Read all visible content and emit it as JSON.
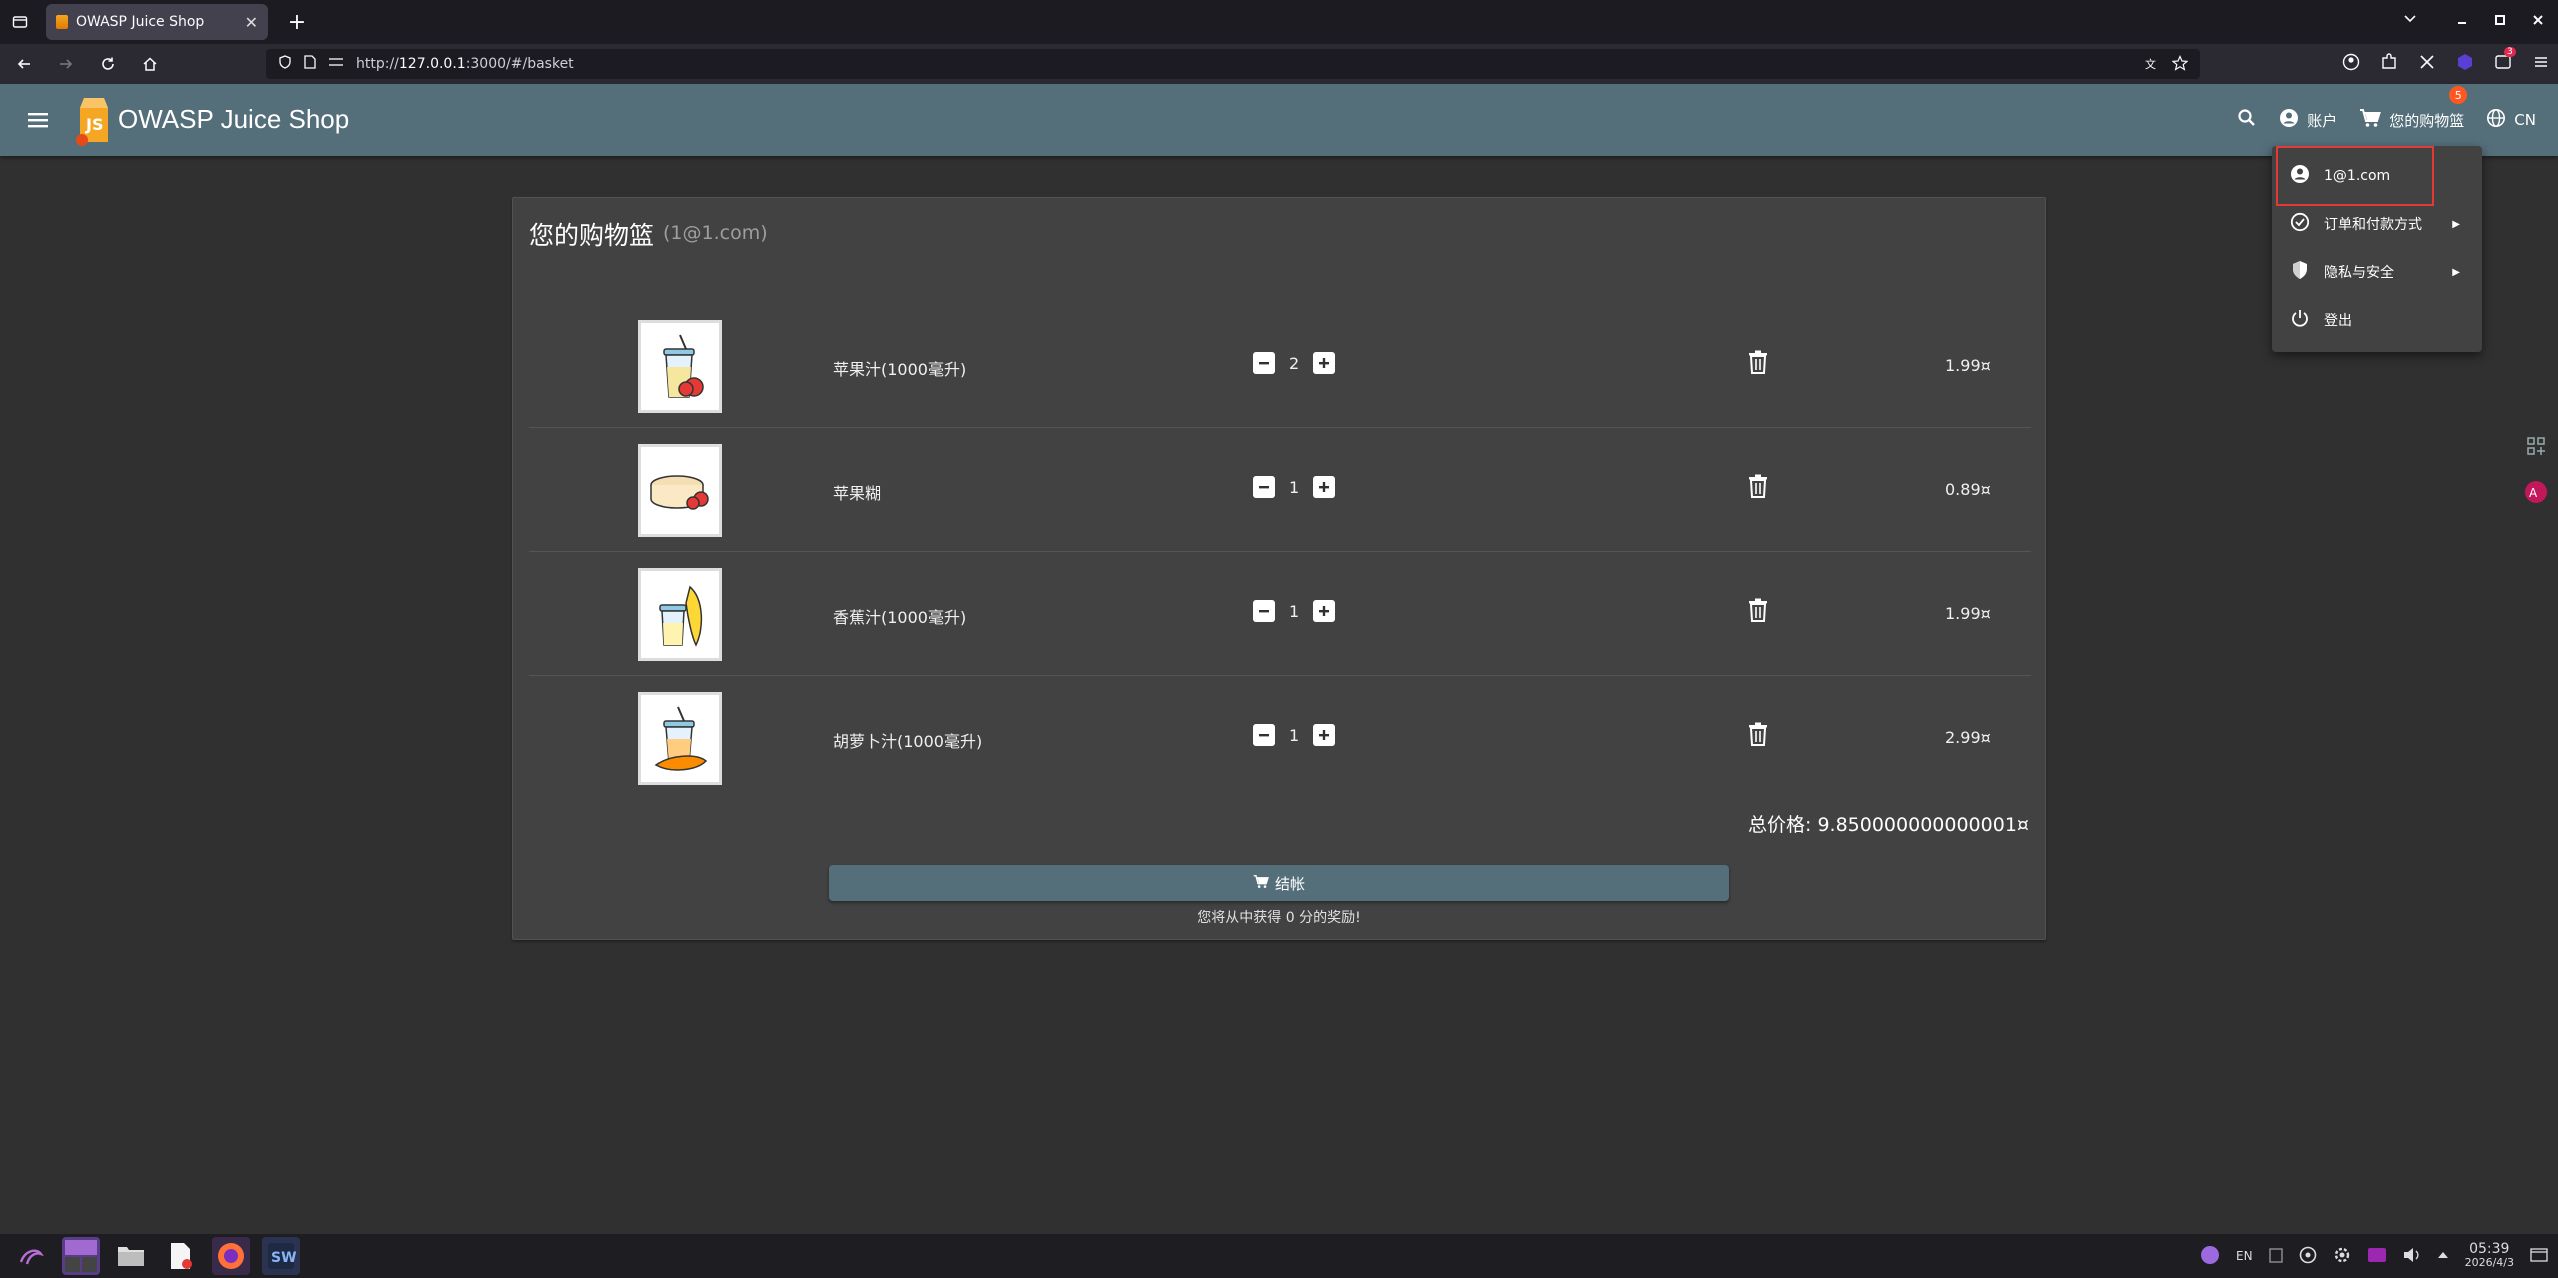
{
  "browser": {
    "tab_title": "OWASP Juice Shop",
    "url_prefix": "http://",
    "url_host": "127.0.0.1",
    "url_rest": ":3000/#/basket",
    "extension_badge": "3"
  },
  "app": {
    "title": "OWASP Juice Shop",
    "account_label": "账户",
    "cart_label": "您的购物篮",
    "cart_count": "5",
    "language_label": "CN"
  },
  "basket": {
    "title": "您的购物篮",
    "user": "(1@1.com)",
    "items": [
      {
        "name": "苹果汁(1000毫升)",
        "quantity": "2",
        "price": "1.99¤",
        "image": "apple-juice-icon"
      },
      {
        "name": "苹果糊",
        "quantity": "1",
        "price": "0.89¤",
        "image": "apple-pomace-icon"
      },
      {
        "name": "香蕉汁(1000毫升)",
        "quantity": "1",
        "price": "1.99¤",
        "image": "banana-juice-icon"
      },
      {
        "name": "胡萝卜汁(1000毫升)",
        "quantity": "1",
        "price": "2.99¤",
        "image": "carrot-juice-icon"
      }
    ],
    "total_label": "总价格:",
    "total_value": "9.850000000000001¤",
    "checkout_label": "结帐",
    "bonus_text": "您将从中获得 0 分的奖励!"
  },
  "account_menu": {
    "email": "1@1.com",
    "orders_label": "订单和付款方式",
    "privacy_label": "隐私与安全",
    "logout_label": "登出"
  },
  "taskbar": {
    "lang": "EN",
    "time": "05:39",
    "date": "2026/4/3"
  },
  "colors": {
    "toolbar": "#546e7a",
    "background": "#303030",
    "card": "#424242",
    "badge": "#ff5722",
    "highlight": "#e53935"
  }
}
